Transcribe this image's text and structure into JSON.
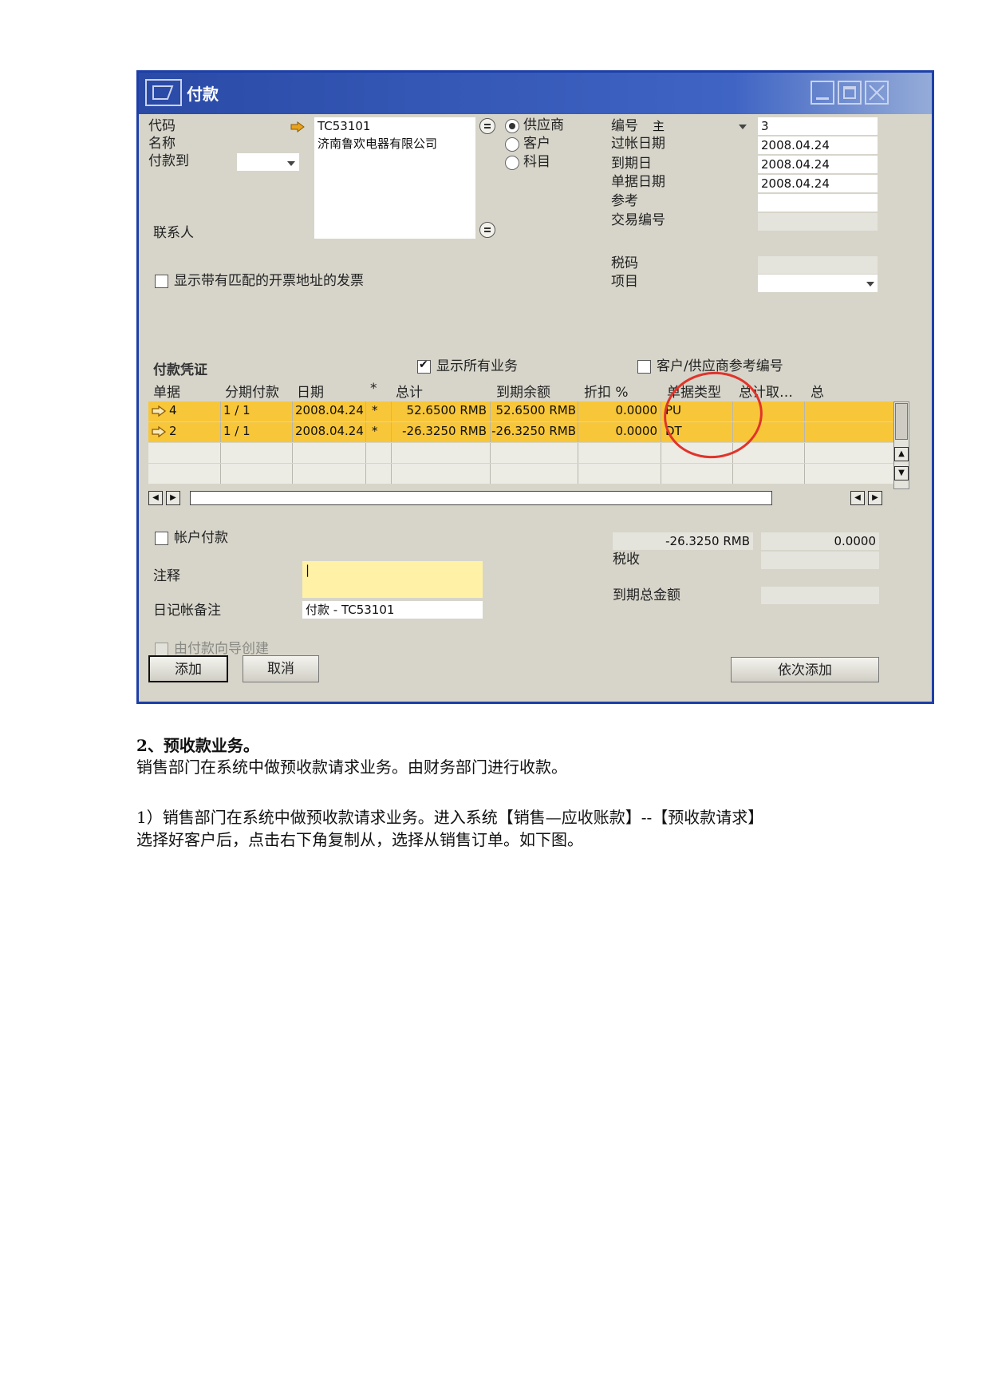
{
  "window": {
    "title": "付款"
  },
  "header_left": {
    "code_label": "代码",
    "code_value": "TC53101",
    "name_label": "名称",
    "name_value": "济南鲁欢电器有限公司",
    "pay_to_label": "付款到",
    "contact_label": "联系人",
    "show_invoices_label": "显示带有匹配的开票地址的发票"
  },
  "partner_type": {
    "options": [
      "供应商",
      "客户",
      "科目"
    ],
    "selected": "供应商"
  },
  "header_right": {
    "number_label": "编号",
    "series_value": "主",
    "number_value": "3",
    "posting_date_label": "过帐日期",
    "posting_date_value": "2008.04.24",
    "due_date_label": "到期日",
    "due_date_value": "2008.04.24",
    "doc_date_label": "单据日期",
    "doc_date_value": "2008.04.24",
    "reference_label": "参考",
    "transaction_no_label": "交易编号",
    "tax_code_label": "税码",
    "project_label": "项目"
  },
  "grid_section": {
    "title": "付款凭证",
    "show_all_label": "显示所有业务",
    "ref_no_label": "客户/供应商参考编号",
    "columns": [
      "单据",
      "分期付款",
      "日期",
      "*",
      "总计",
      "到期余额",
      "折扣 %",
      "单据类型",
      "总计取…",
      "总"
    ],
    "rows": [
      {
        "doc": "4",
        "installment": "1 / 1",
        "date": "2008.04.24",
        "star": "*",
        "total": "52.6500 RMB",
        "balance_due": "52.6500 RMB",
        "discount": "0.0000",
        "doc_type": "PU"
      },
      {
        "doc": "2",
        "installment": "1 / 1",
        "date": "2008.04.24",
        "star": "*",
        "total": "-26.3250 RMB",
        "balance_due": "-26.3250 RMB",
        "discount": "0.0000",
        "doc_type": "DT"
      }
    ]
  },
  "footer_left": {
    "account_payment_label": "帐户付款",
    "remarks_label": "注释",
    "journal_remark_label": "日记帐备注",
    "journal_remark_value": "付款 - TC53101",
    "wizard_label": "由付款向导创建"
  },
  "footer_right": {
    "total_value": "-26.3250 RMB",
    "total_right_value": "0.0000",
    "tax_label": "税收",
    "total_due_label": "到期总金额"
  },
  "buttons": {
    "add": "添加",
    "cancel": "取消",
    "add_in_sequence": "依次添加"
  },
  "document": {
    "heading": "2、预收款业务。",
    "line1": "销售部门在系统中做预收款请求业务。由财务部门进行收款。",
    "line2": "1）销售部门在系统中做预收款请求业务。进入系统【销售—应收账款】--【预收款请求】",
    "line3": "选择好客户后，点击右下角复制从，选择从销售订单。如下图。"
  },
  "colors": {
    "title_bar": "#2a4aa6",
    "selected_row": "#f8c639",
    "annotation_circle": "#e0342b",
    "arrow_icon": "#e8a21b",
    "remark_field": "#fff2a6"
  }
}
